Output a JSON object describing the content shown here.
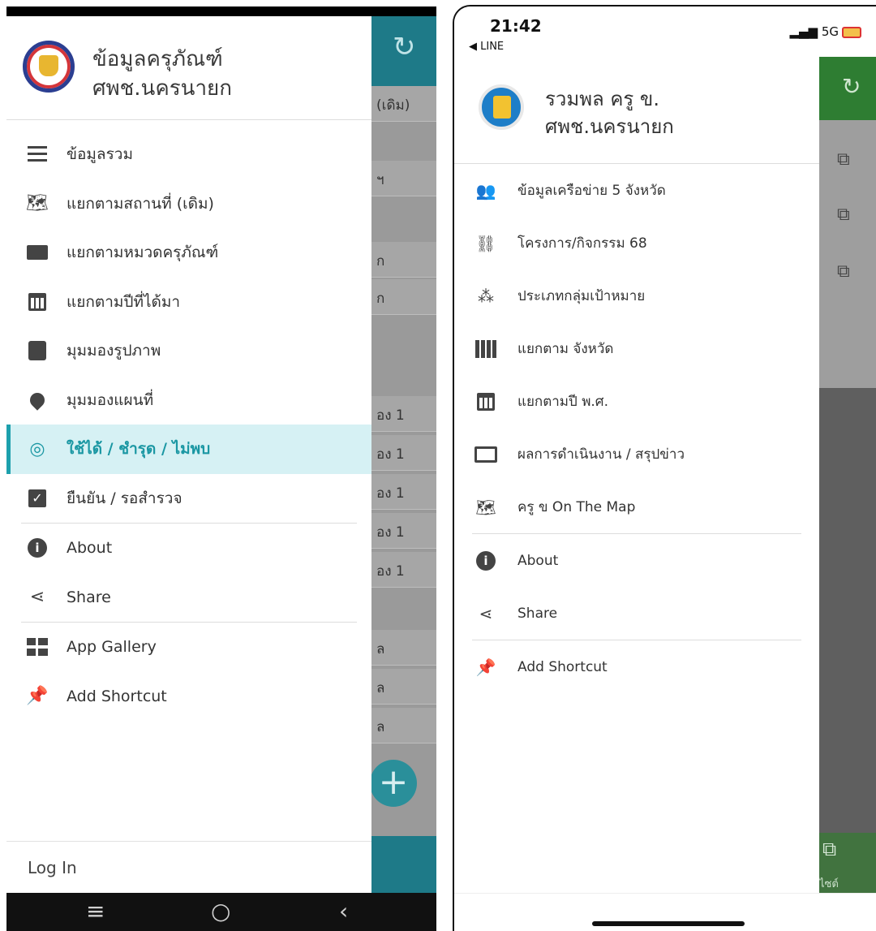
{
  "left_screen": {
    "header": {
      "title_line1": "ข้อมูลครุภัณฑ์",
      "title_line2": "ศพช.นครนายก"
    },
    "menu": [
      {
        "label": "ข้อมูลรวม",
        "icon": "list-icon"
      },
      {
        "label": "แยกตามสถานที่ (เดิม)",
        "icon": "map-icon"
      },
      {
        "label": "แยกตามหมวดครุภัณฑ์",
        "icon": "folder-open-icon"
      },
      {
        "label": "แยกตามปีที่ได้มา",
        "icon": "calendar-icon"
      },
      {
        "label": "มุมมองรูปภาพ",
        "icon": "contact-card-icon"
      },
      {
        "label": "มุมมองแผนที่",
        "icon": "map-marker-icon"
      },
      {
        "label": "ใช้ได้ / ชำรุด / ไม่พบ",
        "icon": "target-icon",
        "active": true
      },
      {
        "label": "ยืนยัน / รอสำรวจ",
        "icon": "checkbox-icon"
      }
    ],
    "menu_secondary": [
      {
        "label": "About",
        "icon": "info-icon"
      },
      {
        "label": "Share",
        "icon": "share-icon"
      }
    ],
    "menu_tertiary": [
      {
        "label": "App Gallery",
        "icon": "grid-icon"
      },
      {
        "label": "Add Shortcut",
        "icon": "pin-icon"
      }
    ],
    "footer": {
      "login_label": "Log In"
    },
    "background": {
      "header_right": "(เดิม)",
      "rows": [
        "ฯ",
        "ก",
        "ก",
        "อง 1",
        "อง 1",
        "อง 1",
        "อง 1",
        "อง 1",
        "ล",
        "ล",
        "ล"
      ]
    },
    "navbar": {
      "menu": "≡",
      "home": "○",
      "back": "‹"
    }
  },
  "right_screen": {
    "status_bar": {
      "time": "21:42",
      "back_app": "◀ LINE",
      "network": "5G"
    },
    "header": {
      "title_line1": "รวมพล ครู ข.",
      "title_line2": "ศพช.นครนายก"
    },
    "menu": [
      {
        "label": "ข้อมูลเครือข่าย 5 จังหวัด",
        "icon": "users-icon"
      },
      {
        "label": "โครงการ/กิจกรรม 68",
        "icon": "sitemap-icon"
      },
      {
        "label": "ประเภทกลุ่มเป้าหมาย",
        "icon": "group-icon"
      },
      {
        "label": "แยกตาม จังหวัด",
        "icon": "building-icon"
      },
      {
        "label": "แยกตามปี พ.ศ.",
        "icon": "calendar-icon"
      },
      {
        "label": "ผลการดำเนินงาน / สรุปข่าว",
        "icon": "monitor-icon"
      },
      {
        "label": "ครู ข On The Map",
        "icon": "map-icon"
      }
    ],
    "menu_secondary": [
      {
        "label": "About",
        "icon": "info-icon"
      },
      {
        "label": "Share",
        "icon": "share-icon"
      }
    ],
    "menu_tertiary": [
      {
        "label": "Add Shortcut",
        "icon": "pin-icon"
      }
    ],
    "background": {
      "bottom_label": "ไซต์"
    }
  },
  "colors": {
    "left_accent": "#1da0ad",
    "left_active_bg": "#d6f1f4",
    "left_appbar": "#1e7a88",
    "right_appbar": "#2e7d32"
  }
}
